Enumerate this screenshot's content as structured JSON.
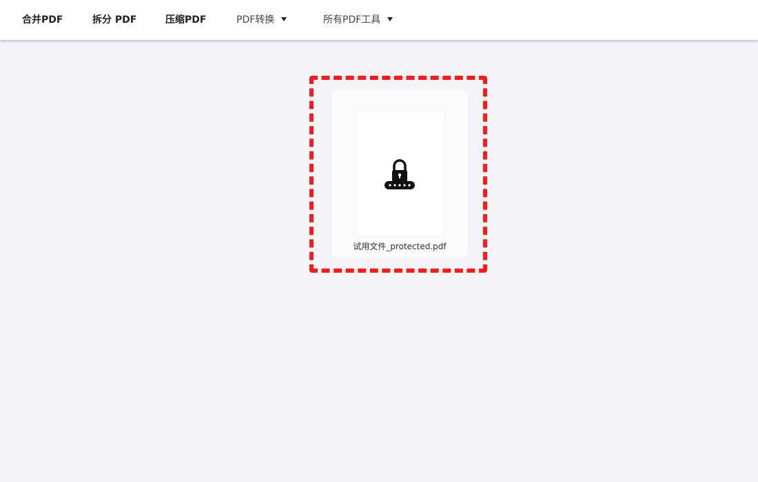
{
  "nav": {
    "merge_pdf": "合并PDF",
    "split_pdf": "拆分 PDF",
    "compress_pdf": "压缩PDF",
    "convert_pdf": "PDF转换",
    "all_tools": "所有PDF工具"
  },
  "file": {
    "name": "试用文件_protected.pdf",
    "icon": "lock-password-icon"
  },
  "colors": {
    "background": "#f4f4f9",
    "highlight_dash": "#ff1a1a",
    "icon": "#111111"
  }
}
